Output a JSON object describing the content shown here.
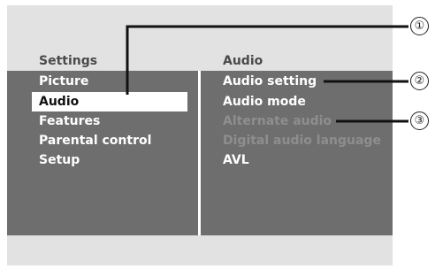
{
  "left_header": "Settings",
  "right_header": "Audio",
  "left_menu": [
    "Picture",
    "Audio",
    "Features",
    "Parental control",
    "Setup"
  ],
  "right_menu": [
    {
      "label": "Audio setting",
      "enabled": true
    },
    {
      "label": "Audio mode",
      "enabled": true
    },
    {
      "label": "Alternate audio",
      "enabled": false
    },
    {
      "label": "Digital audio language",
      "enabled": false
    },
    {
      "label": "AVL",
      "enabled": true
    }
  ],
  "callouts": [
    "①",
    "②",
    "③"
  ],
  "colors": {
    "screen_bg": "#e2e2e2",
    "panel_bg": "#6e6e6e",
    "selected_bg": "#ffffff",
    "disabled_text": "#8e8e8e"
  }
}
